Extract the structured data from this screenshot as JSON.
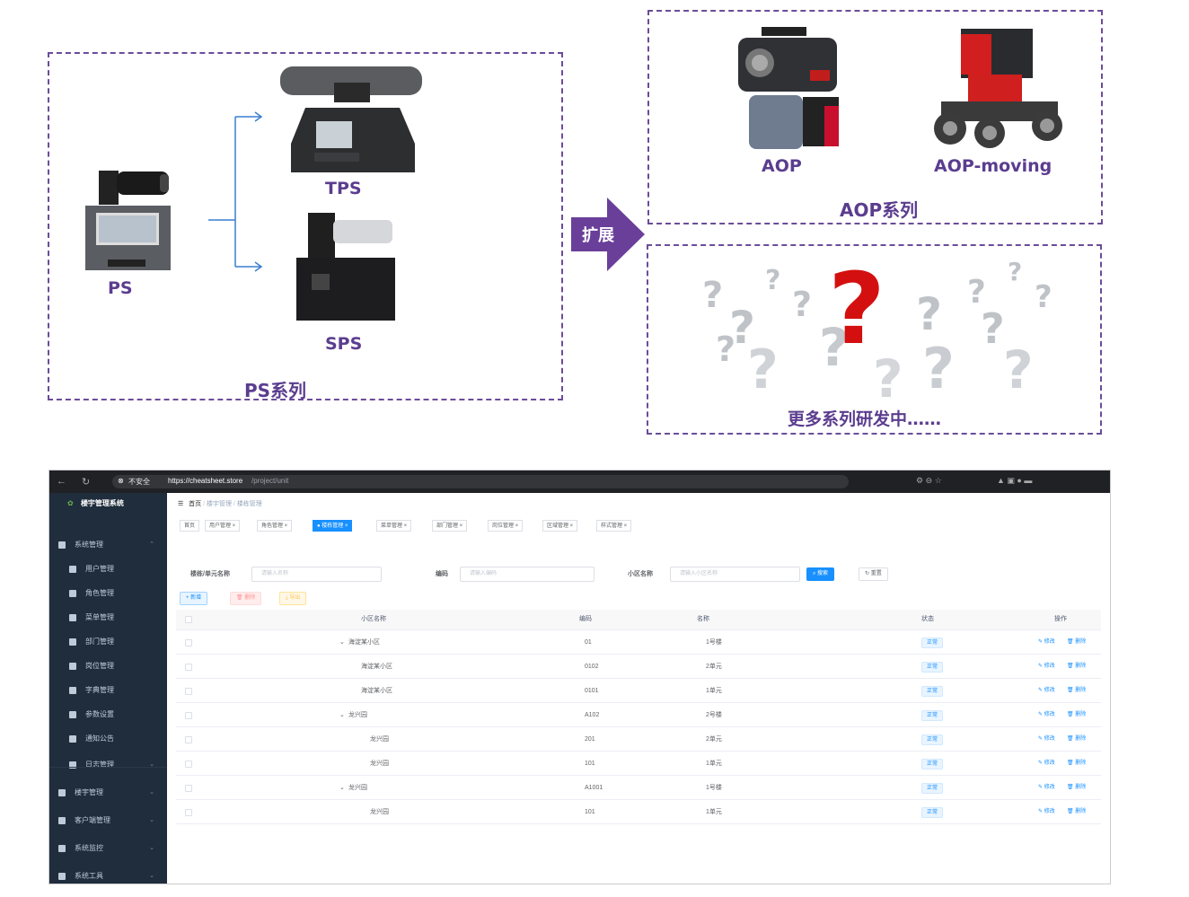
{
  "ps_series": {
    "title": "PS系列",
    "ps": "PS",
    "tps": "TPS",
    "sps": "SPS"
  },
  "expand": {
    "label": "扩展"
  },
  "aop_series": {
    "title": "AOP系列",
    "aop": "AOP",
    "aop_moving": "AOP-moving"
  },
  "more": {
    "label": "更多系列研发中……"
  },
  "browser": {
    "security": "不安全",
    "url_host": "https://cheatsheet.store",
    "url_path": "/project/unit"
  },
  "app": {
    "name": "楼宇管理系统",
    "sidebar": [
      {
        "label": "系统管理",
        "icon": "gear-icon"
      },
      {
        "label": "用户管理",
        "icon": "user-icon"
      },
      {
        "label": "角色管理",
        "icon": "role-icon"
      },
      {
        "label": "菜单管理",
        "icon": "menu-icon"
      },
      {
        "label": "部门管理",
        "icon": "dept-icon"
      },
      {
        "label": "岗位管理",
        "icon": "post-icon"
      },
      {
        "label": "字典管理",
        "icon": "dict-icon"
      },
      {
        "label": "参数设置",
        "icon": "edit-icon"
      },
      {
        "label": "通知公告",
        "icon": "message-icon"
      },
      {
        "label": "日志管理",
        "icon": "log-icon"
      },
      {
        "label": "楼宇管理",
        "icon": "building-icon"
      },
      {
        "label": "客户端管理",
        "icon": "client-icon"
      },
      {
        "label": "系统监控",
        "icon": "monitor-icon"
      },
      {
        "label": "系统工具",
        "icon": "tool-icon"
      }
    ],
    "breadcrumb": [
      "首页",
      "楼宇管理",
      "楼栋管理"
    ],
    "tabs": [
      "首页",
      "用户管理",
      "角色管理",
      "楼栋管理",
      "菜单管理",
      "部门管理",
      "岗位管理",
      "区域管理",
      "样式管理"
    ],
    "search": {
      "name_label": "楼栋/单元名称",
      "name_placeholder": "请输入名称",
      "code_label": "编码",
      "code_placeholder": "请输入编码",
      "community_label": "小区名称",
      "community_placeholder": "请输入小区名称",
      "search_btn": "搜索",
      "reset_btn": "重置"
    },
    "actions": {
      "add": "+ 新增",
      "delete": "删除",
      "export": "导出"
    },
    "table": {
      "headers": [
        "小区名称",
        "编码",
        "名称",
        "状态",
        "操作"
      ],
      "edit": "修改",
      "del": "删除",
      "rows": [
        {
          "community": "海淀某小区",
          "code": "01",
          "name": "1号楼",
          "status": "正常",
          "tree": true
        },
        {
          "community": "海淀某小区",
          "code": "0102",
          "name": "2单元",
          "status": "正常",
          "tree": false
        },
        {
          "community": "海淀某小区",
          "code": "0101",
          "name": "1单元",
          "status": "正常",
          "tree": false
        },
        {
          "community": "龙兴园",
          "code": "A102",
          "name": "2号楼",
          "status": "正常",
          "tree": true
        },
        {
          "community": "龙兴园",
          "code": "201",
          "name": "2单元",
          "status": "正常",
          "tree": false
        },
        {
          "community": "龙兴园",
          "code": "101",
          "name": "1单元",
          "status": "正常",
          "tree": false
        },
        {
          "community": "龙兴园",
          "code": "A1001",
          "name": "1号楼",
          "status": "正常",
          "tree": true
        },
        {
          "community": "龙兴园",
          "code": "101",
          "name": "1单元",
          "status": "正常",
          "tree": false
        }
      ]
    }
  }
}
